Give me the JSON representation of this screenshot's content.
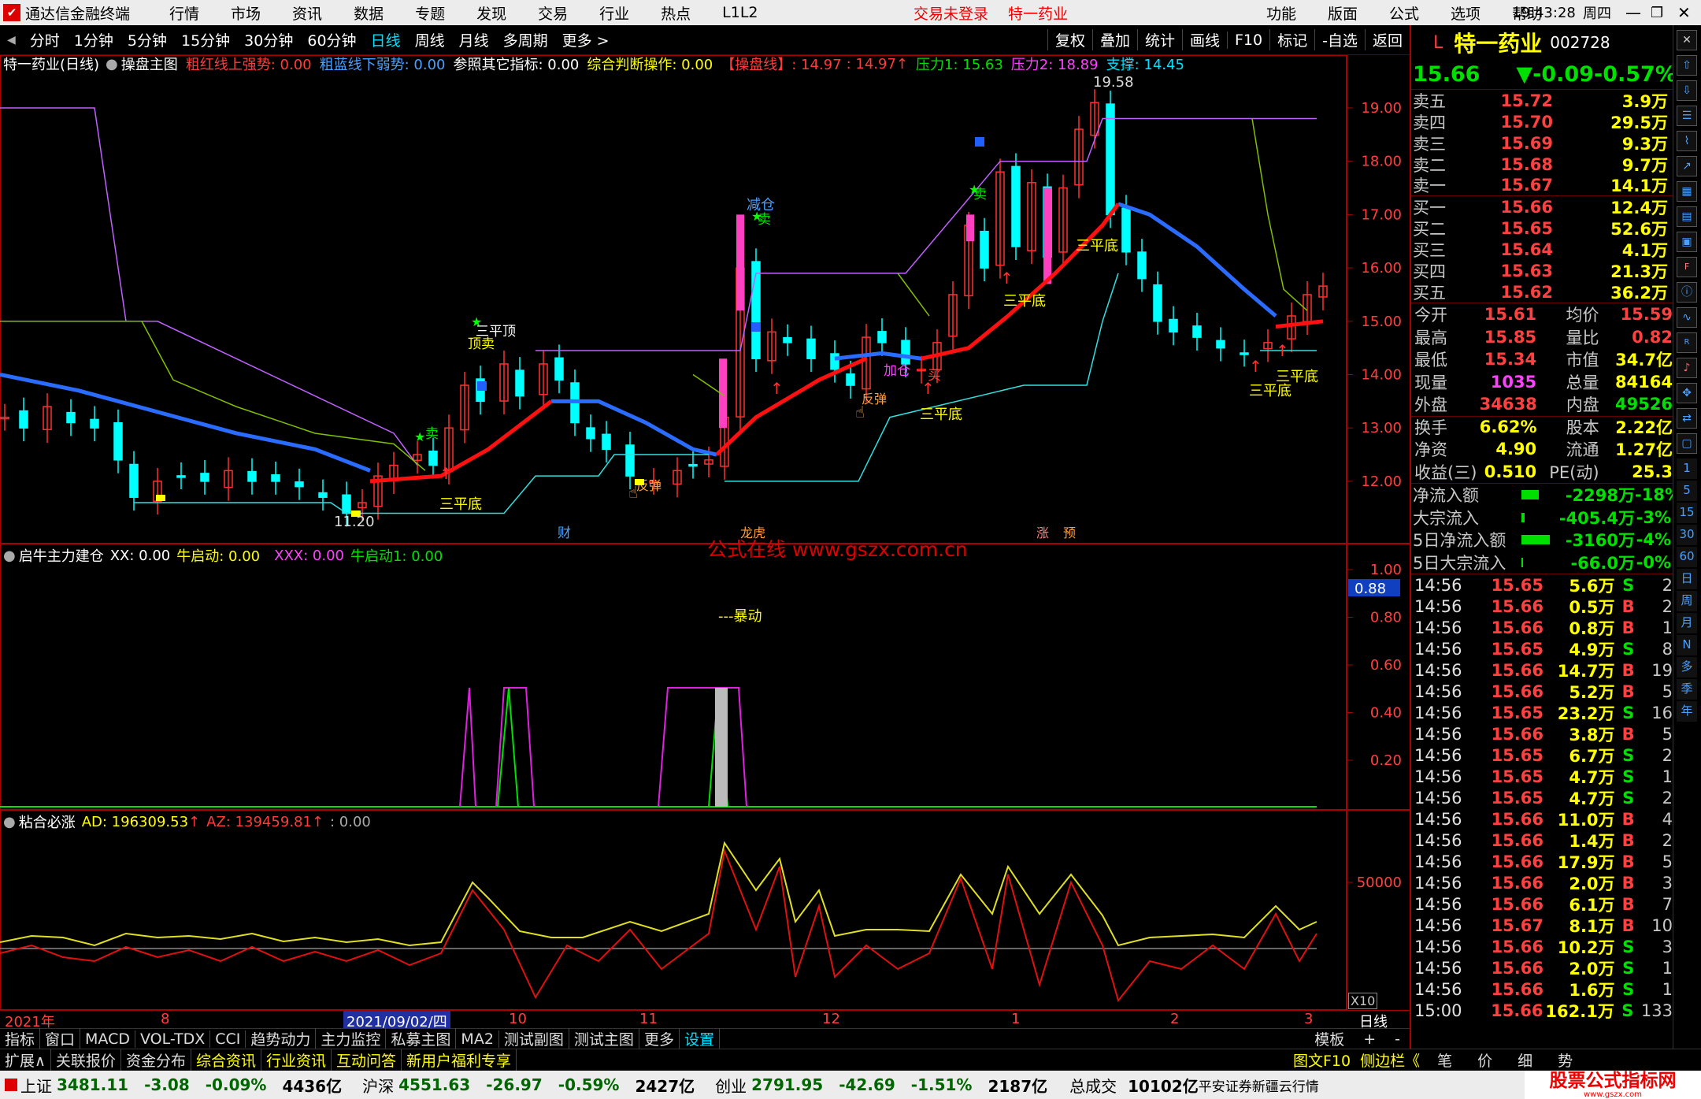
{
  "window": {
    "app_name": "通达信金融终端",
    "login_status": "交易未登录",
    "stock_title": "特一药业",
    "time": "19:43:28",
    "weekday": "周四"
  },
  "menu": [
    "行情",
    "市场",
    "资讯",
    "数据",
    "专题",
    "发现",
    "交易",
    "行业",
    "热点",
    "L1L2"
  ],
  "right_menu": [
    "功能",
    "版面",
    "公式",
    "选项",
    "帮助"
  ],
  "periods": [
    "分时",
    "1分钟",
    "5分钟",
    "15分钟",
    "30分钟",
    "60分钟",
    "日线",
    "周线",
    "月线",
    "多周期",
    "更多 >"
  ],
  "tools": [
    "复权",
    "叠加",
    "统计",
    "画线",
    "F10",
    "标记",
    "-自选",
    "返回"
  ],
  "main_legend": {
    "title": "特一药业(日线)",
    "indicator": "操盘主图",
    "red_label": "粗红线上强势: 0.00",
    "blue_label": "粗蓝线下弱势: 0.00",
    "ref": "参照其它指标: 0.00",
    "judge": "综合判断操作: 0.00",
    "line": "【操盘线】: 14.97",
    "line2": ": 14.97",
    "press1": "压力1: 15.63",
    "press2": "压力2: 18.89",
    "support": "支撑: 14.45"
  },
  "price_axis": [
    "19.00",
    "18.00",
    "17.00",
    "16.00",
    "15.00",
    "14.00",
    "13.00",
    "12.00"
  ],
  "annotations": {
    "high": "19.58",
    "low": "11.20",
    "jiancang": "减仓",
    "sell": "卖",
    "buy": "买",
    "topsell": "顶卖",
    "sanpingding": "三平顶",
    "sanpingdi": "三平底",
    "jiacang": "加仓",
    "fanzhuan": "反弹",
    "cai": "财",
    "longhu": "龙虎",
    "zhang": "涨",
    "yu": "预"
  },
  "watermark": "公式在线  www.gszx.com.cn",
  "sub1_legend": {
    "name": "启牛主力建仓",
    "xx": "XX: 0.00",
    "nqd": "牛启动: 0.00",
    "xxx": "XXX: 0.00",
    "nqd1": "牛启动1: 0.00",
    "baodong": "---暴动"
  },
  "sub1_axis": [
    "1.00",
    "0.80",
    "0.60",
    "0.40",
    "0.20"
  ],
  "sub1_cursor": "0.88",
  "sub2_legend": {
    "name": "粘合必涨",
    "ad": "AD: 196309.53",
    "az": "AZ: 139459.81",
    "zero": ": 0.00"
  },
  "sub2_axis": [
    "50000"
  ],
  "sub2_unit": "X10",
  "date_axis": [
    "2021年",
    "8",
    "2021/09/02/四",
    "10",
    "11",
    "12",
    "1",
    "2",
    "3"
  ],
  "date_axis_period": "日线",
  "bottom_tabs": [
    "指标",
    "窗口",
    "MACD",
    "VOL-TDX",
    "CCI",
    "趋势动力",
    "主力监控",
    "私募主图",
    "MA2",
    "测试副图",
    "测试主图",
    "更多",
    "设置"
  ],
  "bottom_right": [
    "模板",
    "+",
    "-"
  ],
  "info_bar": [
    "扩展∧",
    "关联报价",
    "资金分布",
    "综合资讯",
    "行业资讯",
    "互动问答",
    "新用户福利专享"
  ],
  "info_bar_right": [
    "图文F10",
    "侧边栏《",
    "笔",
    "价",
    "细",
    "势"
  ],
  "stock": {
    "mark": "L",
    "name": "特一药业",
    "code": "002728",
    "price": "15.66",
    "change": "▼-0.09",
    "pct": "-0.57%"
  },
  "order_book": [
    {
      "label": "卖五",
      "price": "15.72",
      "vol": "3.9万"
    },
    {
      "label": "卖四",
      "price": "15.70",
      "vol": "29.5万"
    },
    {
      "label": "卖三",
      "price": "15.69",
      "vol": "9.3万"
    },
    {
      "label": "卖二",
      "price": "15.68",
      "vol": "9.7万"
    },
    {
      "label": "卖一",
      "price": "15.67",
      "vol": "14.1万"
    },
    {
      "label": "买一",
      "price": "15.66",
      "vol": "12.4万"
    },
    {
      "label": "买二",
      "price": "15.65",
      "vol": "52.6万"
    },
    {
      "label": "买三",
      "price": "15.64",
      "vol": "4.1万"
    },
    {
      "label": "买四",
      "price": "15.63",
      "vol": "21.3万"
    },
    {
      "label": "买五",
      "price": "15.62",
      "vol": "36.2万"
    }
  ],
  "stats": [
    [
      "今开",
      "15.61",
      "均价",
      "15.59"
    ],
    [
      "最高",
      "15.85",
      "量比",
      "0.82"
    ],
    [
      "最低",
      "15.34",
      "市值",
      "34.7亿"
    ],
    [
      "现量",
      "1035",
      "总量",
      "84164"
    ],
    [
      "外盘",
      "34638",
      "内盘",
      "49526"
    ],
    [
      "换手",
      "6.62%",
      "股本",
      "2.22亿"
    ],
    [
      "净资",
      "4.90",
      "流通",
      "1.27亿"
    ],
    [
      "收益(三)",
      "0.510",
      "PE(动)",
      "25.3"
    ]
  ],
  "flows": [
    [
      "净流入额",
      "-2298万",
      "-18%"
    ],
    [
      "大宗流入",
      "-405.4万",
      "-3%"
    ],
    [
      "5日净流入额",
      "-3160万",
      "-4%"
    ],
    [
      "5日大宗流入",
      "-66.0万",
      "-0%"
    ]
  ],
  "ticks": [
    [
      "14:56",
      "15.65",
      "5.6万",
      "S",
      "2"
    ],
    [
      "14:56",
      "15.66",
      "0.5万",
      "B",
      "2"
    ],
    [
      "14:56",
      "15.66",
      "0.8万",
      "B",
      "1"
    ],
    [
      "14:56",
      "15.65",
      "4.9万",
      "S",
      "8"
    ],
    [
      "14:56",
      "15.66",
      "14.7万",
      "B",
      "19"
    ],
    [
      "14:56",
      "15.66",
      "5.2万",
      "B",
      "5"
    ],
    [
      "14:56",
      "15.65",
      "23.2万",
      "S",
      "16"
    ],
    [
      "14:56",
      "15.66",
      "3.8万",
      "B",
      "5"
    ],
    [
      "14:56",
      "15.65",
      "6.7万",
      "S",
      "2"
    ],
    [
      "14:56",
      "15.65",
      "4.7万",
      "S",
      "1"
    ],
    [
      "14:56",
      "15.65",
      "4.7万",
      "S",
      "2"
    ],
    [
      "14:56",
      "15.66",
      "11.0万",
      "B",
      "4"
    ],
    [
      "14:56",
      "15.66",
      "1.4万",
      "B",
      "2"
    ],
    [
      "14:56",
      "15.66",
      "17.9万",
      "B",
      "5"
    ],
    [
      "14:56",
      "15.66",
      "2.0万",
      "B",
      "3"
    ],
    [
      "14:56",
      "15.66",
      "6.1万",
      "B",
      "7"
    ],
    [
      "14:56",
      "15.67",
      "8.1万",
      "B",
      "10"
    ],
    [
      "14:56",
      "15.66",
      "10.2万",
      "S",
      "3"
    ],
    [
      "14:56",
      "15.66",
      "2.0万",
      "S",
      "1"
    ],
    [
      "14:56",
      "15.66",
      "1.6万",
      "S",
      "1"
    ],
    [
      "15:00",
      "15.66",
      "162.1万",
      "S",
      "133"
    ]
  ],
  "sidebar_btns": [
    "1",
    "5",
    "15",
    "30",
    "60",
    "日",
    "周",
    "月",
    "N",
    "多",
    "季",
    "年"
  ],
  "status": {
    "sh_name": "上证",
    "sh_val": "3481.11",
    "sh_chg": "-3.08",
    "sh_pct": "-0.09%",
    "sh_amt": "4436亿",
    "sz_name": "沪深",
    "sz_val": "4551.63",
    "sz_chg": "-26.97",
    "sz_pct": "-0.59%",
    "sz_amt": "2427亿",
    "cy_name": "创业",
    "cy_val": "2791.95",
    "cy_chg": "-42.69",
    "cy_pct": "-1.51%",
    "cy_amt": "2187亿",
    "total_label": "总成交",
    "total": "10102亿",
    "broker": "平安证券新疆云行情",
    "site": "股票公式指标网",
    "site_url": "www.gszx.com"
  }
}
